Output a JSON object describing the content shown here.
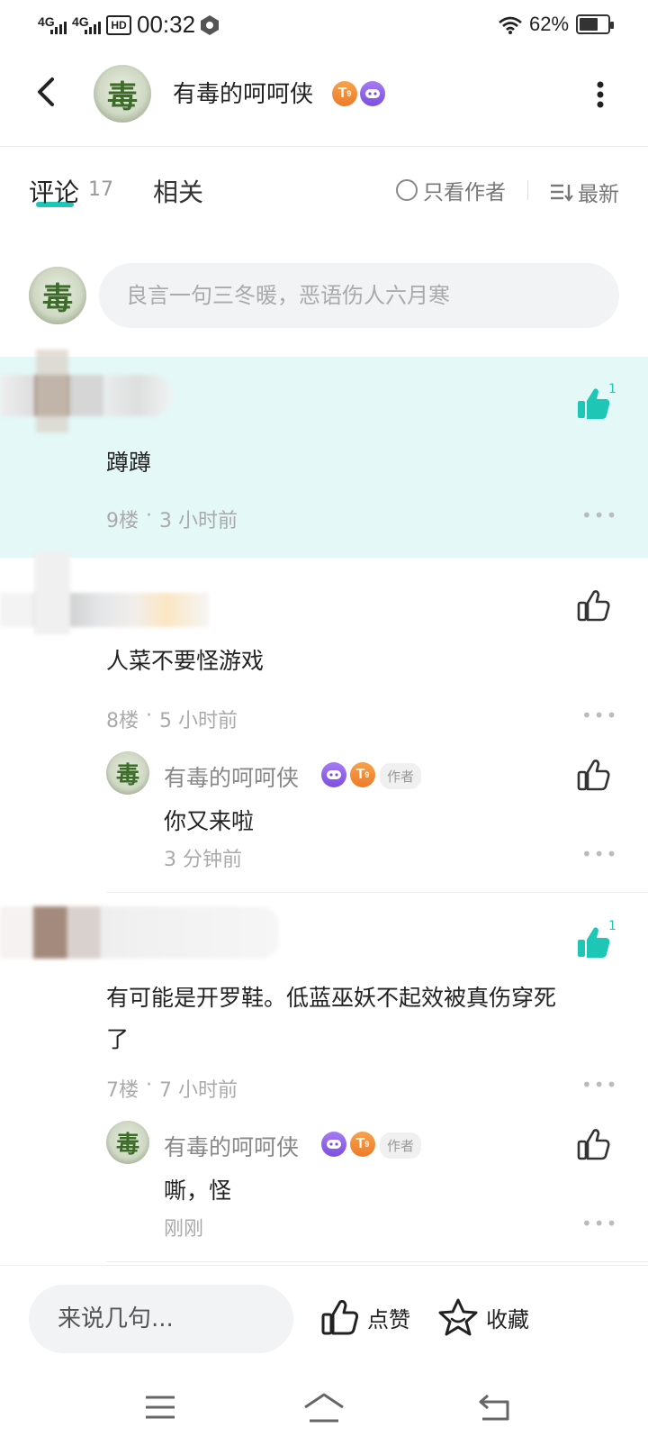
{
  "status_bar": {
    "net1": "4G",
    "net2": "4G",
    "hd": "HD",
    "time": "00:32",
    "battery": "62%"
  },
  "header": {
    "title": "有毒的呵呵侠",
    "badge_t": "T",
    "badge_t_sub": "9"
  },
  "tabs": {
    "comments_label": "评论",
    "comments_count": "17",
    "related_label": "相关",
    "author_only": "只看作者",
    "sort": "最新"
  },
  "composer": {
    "placeholder": "良言一句三冬暖，恶语伤人六月寒"
  },
  "comments": [
    {
      "text": "蹲蹲",
      "floor": "9楼",
      "time": "3 小时前",
      "likes": "1"
    },
    {
      "text": "人菜不要怪游戏",
      "floor": "8楼",
      "time": "5 小时前",
      "likes": ""
    },
    {
      "text_line1": "有可能是开罗鞋。低蓝巫妖不起效被真伤穿死",
      "text_line2": "了",
      "floor": "7楼",
      "time": "7 小时前",
      "likes": "1"
    }
  ],
  "replies": [
    {
      "name": "有毒的呵呵侠",
      "tag": "作者",
      "text": "你又来啦",
      "time": "3 分钟前"
    },
    {
      "name": "有毒的呵呵侠",
      "tag": "作者",
      "text": "嘶，怪",
      "time": "刚刚"
    }
  ],
  "meta_sep": "·",
  "bottom_bar": {
    "input_placeholder": "来说几句...",
    "like_label": "点赞",
    "favorite_label": "收藏"
  },
  "colors": {
    "accent": "#1ec7b5",
    "highlight_bg": "#e4f8f7"
  }
}
